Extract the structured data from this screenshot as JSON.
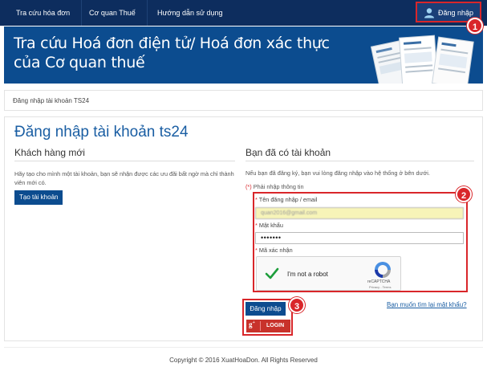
{
  "nav": {
    "items": [
      "Tra cứu hóa đơn",
      "Cơ quan Thuế",
      "Hướng dẫn sử dụng"
    ],
    "login_label": "Đăng nhập"
  },
  "badges": [
    "1",
    "2",
    "3"
  ],
  "banner": {
    "title": "Tra cứu Hoá đơn điện tử/ Hoá đơn xác thực của Cơ quan thuế"
  },
  "breadcrumb": "Đăng nhập tài khoản TS24",
  "page": {
    "title": "Đăng nhập tài khoản ts24",
    "new_customer": {
      "heading": "Khách hàng mới",
      "description": "Hãy tạo cho mình một tài khoản, bạn sẽ nhận được các ưu đãi bất ngờ mà chỉ thành viên mới có.",
      "create_button": "Tạo tài khoản"
    },
    "existing": {
      "heading": "Bạn đã có tài khoản",
      "description": "Nếu bạn đã đăng ký, bạn vui lòng đăng nhập vào hệ thống ở bên dưới.",
      "required_mark": "(*)",
      "required_note": " Phải nhập thông tin",
      "username_label": "Tên đăng nhập / email",
      "username_value": "quan2016@gmail.com",
      "password_label": "Mật khẩu",
      "password_value": "•••••••",
      "captcha_label": "Mã xác nhận",
      "login_button": "Đăng nhập",
      "gplus_button": "LOGIN",
      "forgot_link": "Bạn muốn tìm lại mật khẩu?"
    }
  },
  "recaptcha": {
    "text": "I'm not a robot",
    "brand": "reCAPTCHA",
    "links": "Privacy - Terms"
  },
  "footer": "Copyright © 2016 XuatHoaDon. All Rights Reserved",
  "colors": {
    "nav_bg": "#0d2d5e",
    "banner_bg": "#0c4c8f",
    "accent_red": "#d9262a",
    "link_blue": "#1a5ea3"
  }
}
